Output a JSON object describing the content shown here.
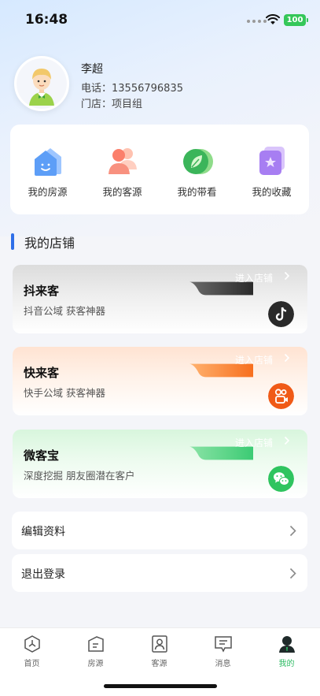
{
  "status_bar": {
    "time": "16:48",
    "battery": "100",
    "battery_color": "#35c759"
  },
  "profile": {
    "name": "李超",
    "phone": "电话：13556796835",
    "store": "门店：项目组"
  },
  "quick_actions": [
    {
      "label": "我的房源",
      "icon": "house-icon"
    },
    {
      "label": "我的客源",
      "icon": "clients-icon"
    },
    {
      "label": "我的带看",
      "icon": "leaf-icon"
    },
    {
      "label": "我的收藏",
      "icon": "favorites-icon"
    }
  ],
  "section": {
    "title": "我的店铺",
    "accent": "#2f6fe8"
  },
  "shops": [
    {
      "name": "抖来客",
      "desc": "抖音公域 获客神器",
      "enter": "进入店铺",
      "icon": "tiktok-icon",
      "accent": "#2d2d2d"
    },
    {
      "name": "快来客",
      "desc": "快手公域 获客神器",
      "enter": "进入店铺",
      "icon": "kuaishou-icon",
      "accent": "#f76f1e"
    },
    {
      "name": "微客宝",
      "desc": "深度挖掘 朋友圈潜在客户",
      "enter": "进入店铺",
      "icon": "wechat-icon",
      "accent": "#3ccb74"
    }
  ],
  "menu": {
    "edit_profile": "编辑资料",
    "logout": "退出登录"
  },
  "tabbar": {
    "items": [
      {
        "label": "首页",
        "icon": "home-tab-icon"
      },
      {
        "label": "房源",
        "icon": "listings-tab-icon"
      },
      {
        "label": "客源",
        "icon": "clients-tab-icon"
      },
      {
        "label": "消息",
        "icon": "messages-tab-icon"
      },
      {
        "label": "我的",
        "icon": "profile-tab-icon"
      }
    ],
    "active": "我的",
    "active_color": "#2dbb63"
  }
}
